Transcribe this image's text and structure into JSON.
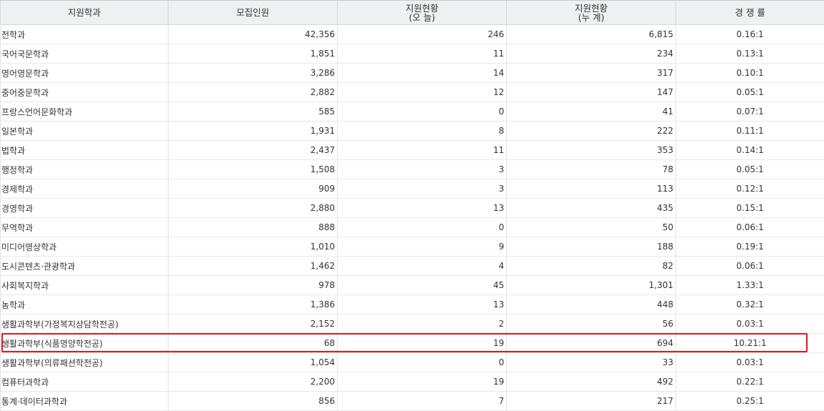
{
  "headers": {
    "dept": "지원학과",
    "quota": "모집인원",
    "today_l1": "지원현황",
    "today_l2": "(오  늘)",
    "total_l1": "지원현황",
    "total_l2": "(누  계)",
    "ratio": "경 쟁 률"
  },
  "rows": [
    {
      "dept": "전학과",
      "quota": "42,356",
      "today": "246",
      "total": "6,815",
      "ratio": "0.16:1"
    },
    {
      "dept": "국어국문학과",
      "quota": "1,851",
      "today": "11",
      "total": "234",
      "ratio": "0.13:1"
    },
    {
      "dept": "영어영문학과",
      "quota": "3,286",
      "today": "14",
      "total": "317",
      "ratio": "0.10:1"
    },
    {
      "dept": "중어중문학과",
      "quota": "2,882",
      "today": "12",
      "total": "147",
      "ratio": "0.05:1"
    },
    {
      "dept": "프랑스언어문화학과",
      "quota": "585",
      "today": "0",
      "total": "41",
      "ratio": "0.07:1"
    },
    {
      "dept": "일본학과",
      "quota": "1,931",
      "today": "8",
      "total": "222",
      "ratio": "0.11:1"
    },
    {
      "dept": "법학과",
      "quota": "2,437",
      "today": "11",
      "total": "353",
      "ratio": "0.14:1"
    },
    {
      "dept": "행정학과",
      "quota": "1,508",
      "today": "3",
      "total": "78",
      "ratio": "0.05:1"
    },
    {
      "dept": "경제학과",
      "quota": "909",
      "today": "3",
      "total": "113",
      "ratio": "0.12:1"
    },
    {
      "dept": "경영학과",
      "quota": "2,880",
      "today": "13",
      "total": "435",
      "ratio": "0.15:1"
    },
    {
      "dept": "무역학과",
      "quota": "888",
      "today": "0",
      "total": "50",
      "ratio": "0.06:1"
    },
    {
      "dept": "미디어영상학과",
      "quota": "1,010",
      "today": "9",
      "total": "188",
      "ratio": "0.19:1"
    },
    {
      "dept": "도시콘텐츠·관광학과",
      "quota": "1,462",
      "today": "4",
      "total": "82",
      "ratio": "0.06:1"
    },
    {
      "dept": "사회복지학과",
      "quota": "978",
      "today": "45",
      "total": "1,301",
      "ratio": "1.33:1"
    },
    {
      "dept": "농학과",
      "quota": "1,386",
      "today": "13",
      "total": "448",
      "ratio": "0.32:1"
    },
    {
      "dept": "생활과학부(가정복지상담학전공)",
      "quota": "2,152",
      "today": "2",
      "total": "56",
      "ratio": "0.03:1"
    },
    {
      "dept": "생활과학부(식품영양학전공)",
      "quota": "68",
      "today": "19",
      "total": "694",
      "ratio": "10.21:1"
    },
    {
      "dept": "생활과학부(의류패션학전공)",
      "quota": "1,054",
      "today": "0",
      "total": "33",
      "ratio": "0.03:1"
    },
    {
      "dept": "컴퓨터과학과",
      "quota": "2,200",
      "today": "19",
      "total": "492",
      "ratio": "0.22:1"
    },
    {
      "dept": "통계·데이터과학과",
      "quota": "856",
      "today": "7",
      "total": "217",
      "ratio": "0.25:1"
    }
  ],
  "highlight_color": "#e0171b"
}
